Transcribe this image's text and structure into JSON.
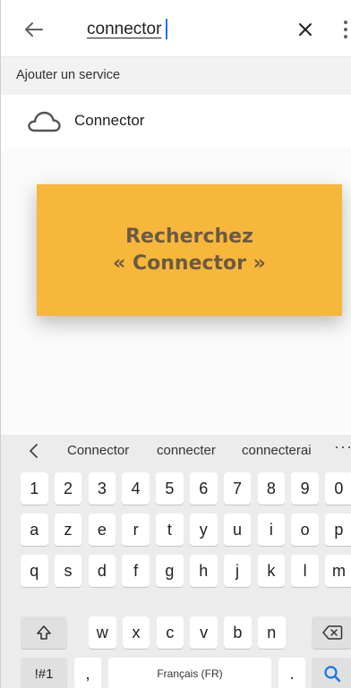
{
  "search": {
    "query": "connector",
    "back_icon": "arrow-left-icon",
    "clear_icon": "close-icon",
    "more_icon": "more-vert-icon"
  },
  "section": {
    "title": "Ajouter un service"
  },
  "results": [
    {
      "label": "Connector",
      "icon": "cloud-outline-icon"
    }
  ],
  "annotation": {
    "text": "Recherchez\n« Connector »",
    "color": "#f7b73b"
  },
  "keyboard": {
    "suggestions": [
      "Connector",
      "connecter",
      "connecterai"
    ],
    "more_label": "···",
    "rows": [
      [
        "1",
        "2",
        "3",
        "4",
        "5",
        "6",
        "7",
        "8",
        "9",
        "0"
      ],
      [
        "a",
        "z",
        "e",
        "r",
        "t",
        "y",
        "u",
        "i",
        "o",
        "p"
      ],
      [
        "q",
        "s",
        "d",
        "f",
        "g",
        "h",
        "j",
        "k",
        "l",
        "m"
      ],
      [
        "w",
        "x",
        "c",
        "v",
        "b",
        "n"
      ]
    ],
    "symbols_label": "!#1",
    "comma_label": ",",
    "space_label": "Français (FR)",
    "period_label": "."
  }
}
